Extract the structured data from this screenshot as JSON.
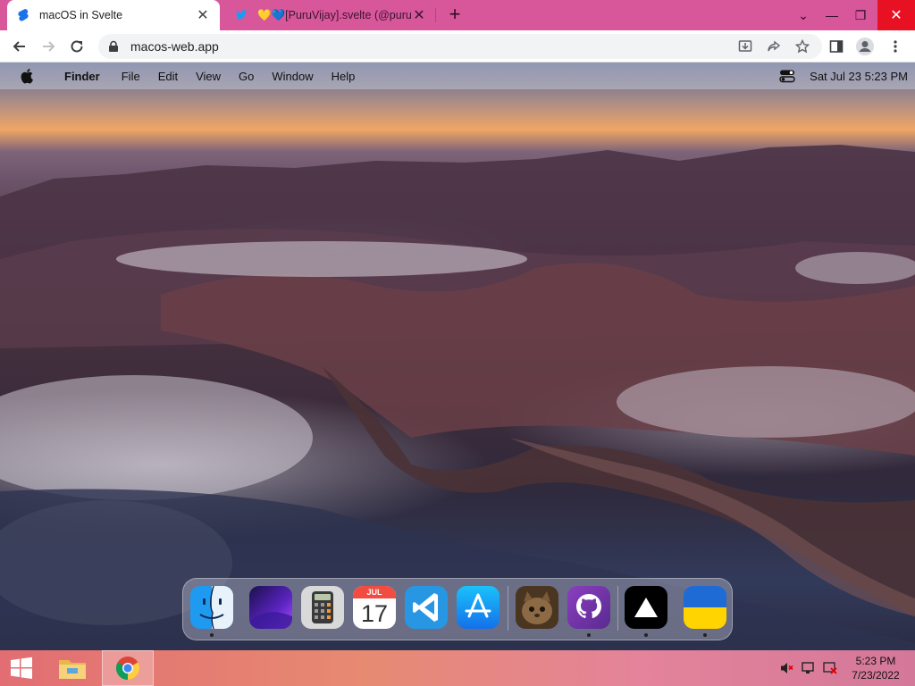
{
  "browser": {
    "tabs": [
      {
        "title": "macOS in Svelte",
        "active": true
      },
      {
        "title": "💛💙[PuruVijay].svelte (@puruvjdev)",
        "active": false
      }
    ],
    "close_glyph": "✕",
    "new_tab_glyph": "+",
    "window_controls": {
      "dropdown": "⌄",
      "minimize": "—",
      "restore": "❐",
      "close": "✕"
    },
    "url": "macos-web.app"
  },
  "macos": {
    "menubar": {
      "app_name": "Finder",
      "menus": [
        "File",
        "Edit",
        "View",
        "Go",
        "Window",
        "Help"
      ],
      "clock": "Sat Jul 23   5:23 PM"
    },
    "dock": {
      "items": [
        {
          "name": "finder",
          "running": true
        },
        {
          "name": "wallpapers",
          "running": false
        },
        {
          "name": "calculator",
          "running": false
        },
        {
          "name": "calendar",
          "running": false,
          "month": "JUL",
          "day": "17"
        },
        {
          "name": "vscode",
          "running": false
        },
        {
          "name": "app-store",
          "running": false
        },
        {
          "name": "purus-twitter",
          "running": false
        },
        {
          "name": "github",
          "running": true
        },
        {
          "name": "vercel",
          "running": true
        },
        {
          "name": "ukraine",
          "running": true
        }
      ]
    }
  },
  "taskbar": {
    "time": "5:23 PM",
    "date": "7/23/2022"
  },
  "colors": {
    "tabstrip": "#d8579b",
    "close_button": "#e81123",
    "taskbar_start": "#e26e73"
  }
}
